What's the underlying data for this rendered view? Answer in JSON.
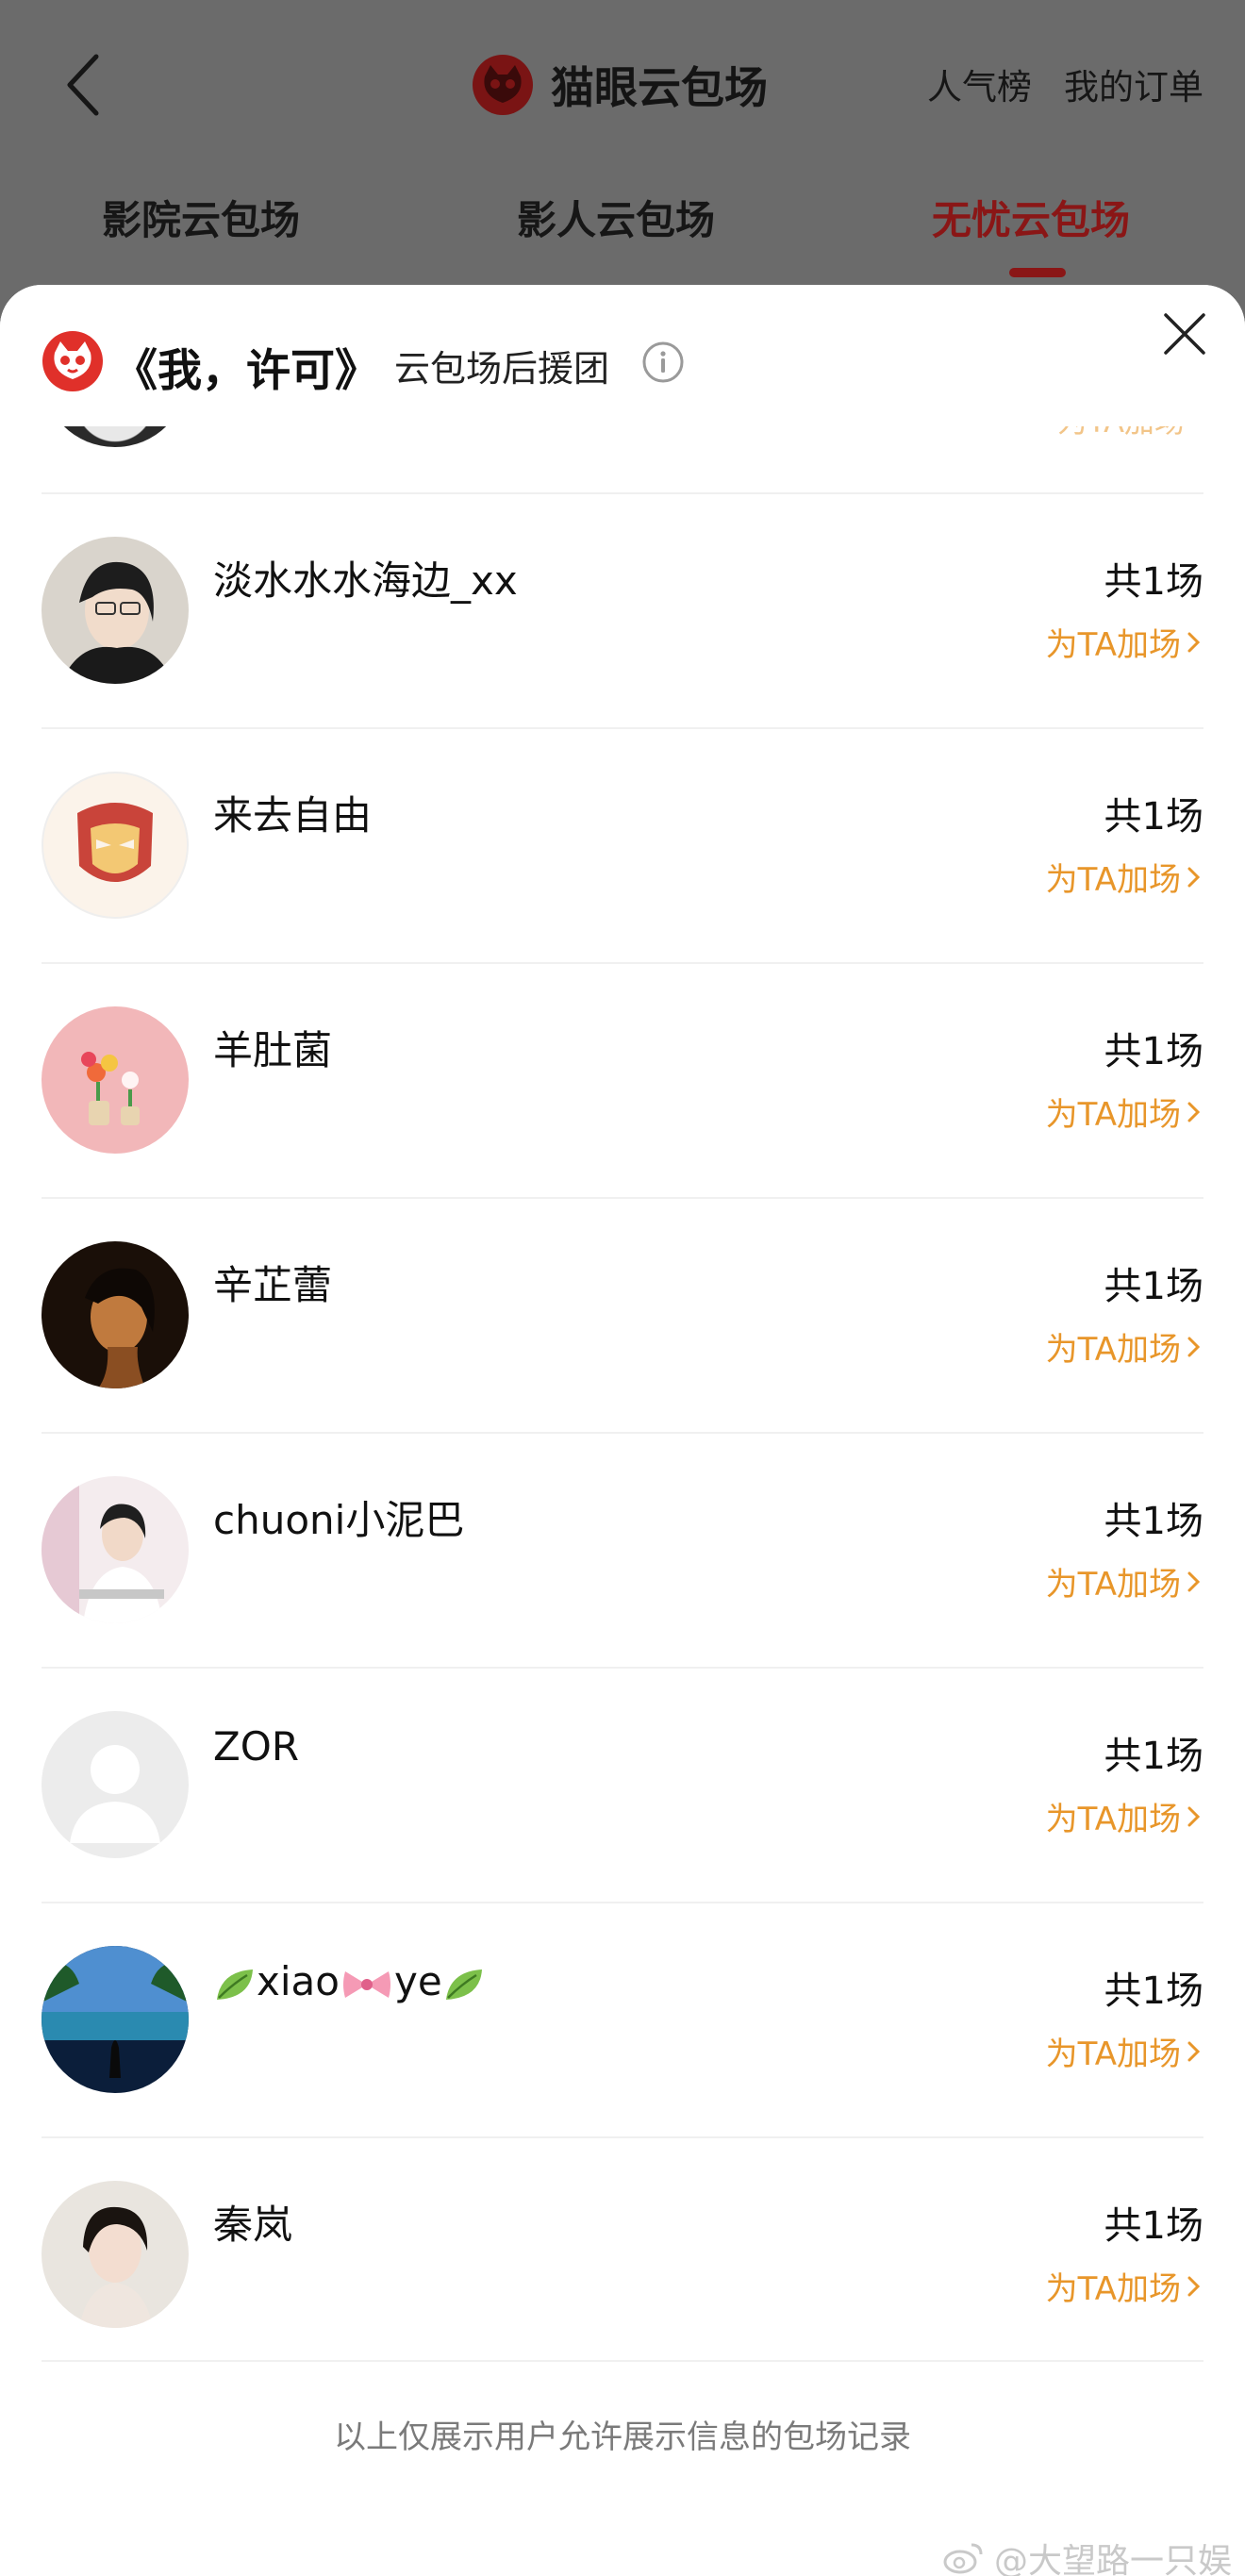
{
  "header": {
    "title": "猫眼云包场",
    "links": [
      "人气榜",
      "我的订单"
    ]
  },
  "tabs": [
    "影院云包场",
    "影人云包场",
    "无忧云包场"
  ],
  "active_tab": 2,
  "sheet": {
    "title": "《我，许可》",
    "subtitle": "云包场后援团",
    "partial_action": "为TA加场"
  },
  "supporters": [
    {
      "name": "淡水水水海边_xx",
      "count": "共1场",
      "action": "为TA加场"
    },
    {
      "name": "来去自由",
      "count": "共1场",
      "action": "为TA加场"
    },
    {
      "name": "羊肚菌",
      "count": "共1场",
      "action": "为TA加场"
    },
    {
      "name": "辛芷蕾",
      "count": "共1场",
      "action": "为TA加场"
    },
    {
      "name": "chuoni小泥巴",
      "count": "共1场",
      "action": "为TA加场"
    },
    {
      "name": "ZOR",
      "count": "共1场",
      "action": "为TA加场"
    },
    {
      "name": "xiao",
      "name_part2": "ye",
      "count": "共1场",
      "action": "为TA加场"
    },
    {
      "name": "秦岚",
      "count": "共1场",
      "action": "为TA加场"
    }
  ],
  "footer_note": "以上仅展示用户允许展示信息的包场记录",
  "watermark": "@大望路一只娱",
  "colors": {
    "accent": "#e8962a",
    "brand_red": "#e0302a",
    "active_tab": "#8a1616"
  }
}
